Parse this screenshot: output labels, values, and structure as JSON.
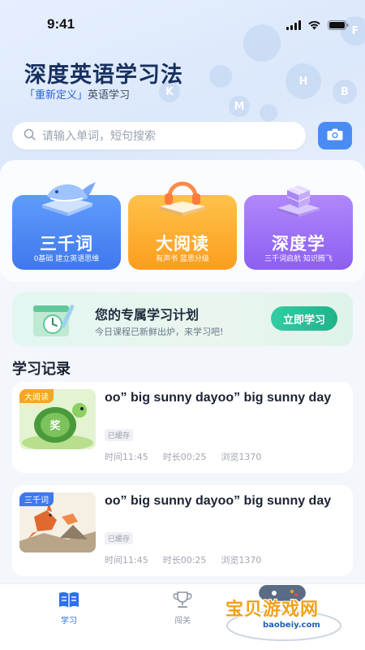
{
  "status_bar": {
    "time": "9:41"
  },
  "header": {
    "title": "深度英语学习法",
    "subtitle_highlight": "「重新定义」",
    "subtitle_rest": "英语学习"
  },
  "search": {
    "placeholder": "请输入单词，短句搜索"
  },
  "cards": [
    {
      "title": "三千词",
      "subtitle": "0基础 建立英语思维"
    },
    {
      "title": "大阅读",
      "subtitle": "有声书 蓝思分级"
    },
    {
      "title": "深度学",
      "subtitle": "三千词启航 知识腾飞"
    }
  ],
  "plan": {
    "title": "您的专属学习计划",
    "subtitle": "今日课程已新鲜出炉，来学习吧!",
    "button": "立即学习"
  },
  "records_section": {
    "title": "学习记录"
  },
  "records": [
    {
      "tag": "大阅读",
      "title": "oo” big sunny dayoo” big sunny day",
      "badge": "已缓存",
      "time": "时间11:45",
      "duration": "时长00:25",
      "views": "浏览1370"
    },
    {
      "tag": "三千词",
      "title": "oo” big sunny dayoo” big sunny day",
      "badge": "已缓存",
      "time": "时间11:45",
      "duration": "时长00:25",
      "views": "浏览1370"
    }
  ],
  "tabs": [
    {
      "label": "学习",
      "active": true
    },
    {
      "label": "闯关",
      "active": false
    }
  ],
  "watermark": {
    "text": "宝贝游戏网",
    "url": "baobeiy.com"
  },
  "colors": {
    "accent": "#4a8cf5",
    "card_blue": "#3f78ee",
    "card_orange": "#fb9d1f",
    "card_purple": "#8c5ff0",
    "plan_button": "#1fb38a"
  }
}
